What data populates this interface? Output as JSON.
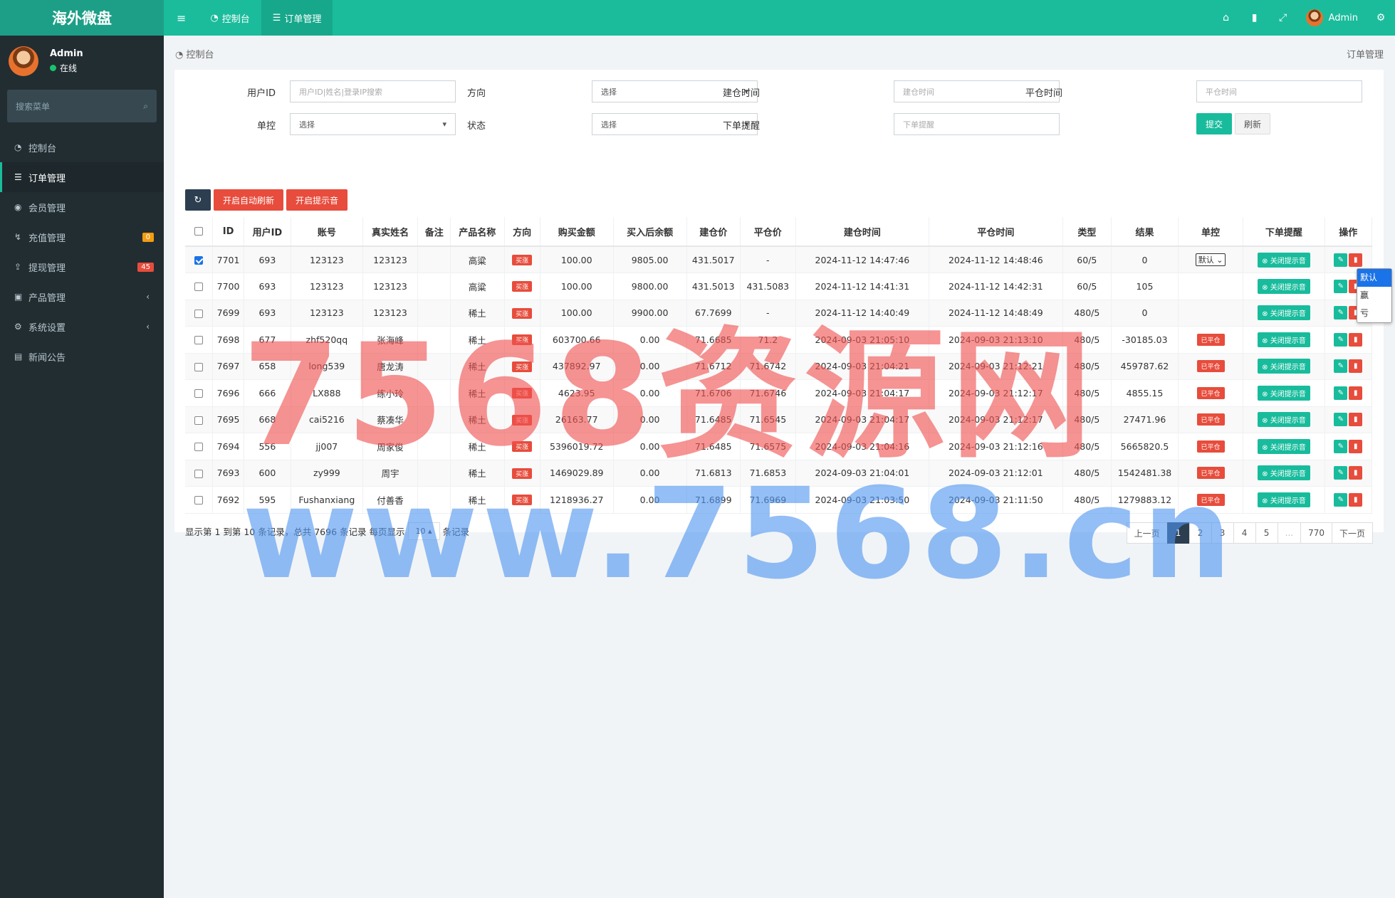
{
  "app": {
    "logo": "海外微盘"
  },
  "user": {
    "name": "Admin",
    "status": "在线"
  },
  "sidebar": {
    "search_placeholder": "搜索菜单",
    "items": [
      {
        "label": "控制台",
        "icon": "dashboard-icon"
      },
      {
        "label": "订单管理",
        "icon": "list-icon",
        "active": true
      },
      {
        "label": "会员管理",
        "icon": "users-icon"
      },
      {
        "label": "充值管理",
        "icon": "recharge-icon",
        "badge": "0",
        "badge_color": "#f39c12"
      },
      {
        "label": "提现管理",
        "icon": "withdraw-icon",
        "badge": "45",
        "badge_color": "#e74c3c"
      },
      {
        "label": "产品管理",
        "icon": "product-icon",
        "caret": "‹"
      },
      {
        "label": "系统设置",
        "icon": "settings-icon",
        "caret": "‹"
      },
      {
        "label": "新闻公告",
        "icon": "news-icon"
      }
    ]
  },
  "topbar": {
    "menu_icon": "≡",
    "tabs": [
      {
        "label": "控制台"
      },
      {
        "label": "订单管理"
      }
    ],
    "admin": "Admin"
  },
  "breadcrumb": {
    "left": "控制台",
    "right": "订单管理"
  },
  "filters": {
    "user_id_label": "用户ID",
    "user_id_placeholder": "用户ID|姓名|登录IP搜索",
    "direction_label": "方向",
    "direction_value": "选择",
    "open_time_label": "建仓时间",
    "open_time_placeholder": "建仓时间",
    "close_time_label": "平仓时间",
    "close_time_placeholder": "平仓时间",
    "control_label": "单控",
    "control_value": "选择",
    "status_label": "状态",
    "status_value": "选择",
    "order_alert_label": "下单提醒",
    "order_alert_placeholder": "下单提醒",
    "submit": "提交",
    "refresh": "刷新"
  },
  "toolbar": {
    "auto_refresh": "开启自动刷新",
    "sound": "开启提示音"
  },
  "table": {
    "headers": [
      "ID",
      "用户ID",
      "账号",
      "真实姓名",
      "备注",
      "产品名称",
      "方向",
      "购买金额",
      "买入后余额",
      "建仓价",
      "平仓价",
      "建仓时间",
      "平仓时间",
      "类型",
      "结果",
      "单控",
      "下单提醒",
      "操作"
    ],
    "direction_tag": "买涨",
    "closed_tag": "已平仓",
    "alert_btn": "关闭提示音",
    "control_default": "默认",
    "rows": [
      {
        "checked": true,
        "id": "7701",
        "uid": "693",
        "account": "123123",
        "name": "123123",
        "note": "",
        "product": "高粱",
        "amount": "100.00",
        "balance": "9805.00",
        "open": "431.5017",
        "close": "-",
        "open_time": "2024-11-12 14:47:46",
        "close_time": "2024-11-12 14:48:46",
        "type": "60/5",
        "result": "0",
        "control": "select"
      },
      {
        "checked": false,
        "id": "7700",
        "uid": "693",
        "account": "123123",
        "name": "123123",
        "note": "",
        "product": "高粱",
        "amount": "100.00",
        "balance": "9800.00",
        "open": "431.5013",
        "close": "431.5083",
        "open_time": "2024-11-12 14:41:31",
        "close_time": "2024-11-12 14:42:31",
        "type": "60/5",
        "result": "105",
        "control": "none"
      },
      {
        "checked": false,
        "id": "7699",
        "uid": "693",
        "account": "123123",
        "name": "123123",
        "note": "",
        "product": "稀土",
        "amount": "100.00",
        "balance": "9900.00",
        "open": "67.7699",
        "close": "-",
        "open_time": "2024-11-12 14:40:49",
        "close_time": "2024-11-12 14:48:49",
        "type": "480/5",
        "result": "0",
        "control": "none"
      },
      {
        "checked": false,
        "id": "7698",
        "uid": "677",
        "account": "zhf520qq",
        "name": "张海峰",
        "note": "",
        "product": "稀土",
        "amount": "603700.66",
        "balance": "0.00",
        "open": "71.6685",
        "close": "71.2",
        "open_time": "2024-09-03 21:05:10",
        "close_time": "2024-09-03 21:13:10",
        "type": "480/5",
        "result": "-30185.03",
        "control": "closed"
      },
      {
        "checked": false,
        "id": "7697",
        "uid": "658",
        "account": "long539",
        "name": "唐龙涛",
        "note": "",
        "product": "稀土",
        "amount": "437892.97",
        "balance": "0.00",
        "open": "71.6712",
        "close": "71.6742",
        "open_time": "2024-09-03 21:04:21",
        "close_time": "2024-09-03 21:12:21",
        "type": "480/5",
        "result": "459787.62",
        "control": "closed"
      },
      {
        "checked": false,
        "id": "7696",
        "uid": "666",
        "account": "LX888",
        "name": "练小玲",
        "note": "",
        "product": "稀土",
        "amount": "4623.95",
        "balance": "0.00",
        "open": "71.6706",
        "close": "71.6746",
        "open_time": "2024-09-03 21:04:17",
        "close_time": "2024-09-03 21:12:17",
        "type": "480/5",
        "result": "4855.15",
        "control": "closed"
      },
      {
        "checked": false,
        "id": "7695",
        "uid": "668",
        "account": "cai5216",
        "name": "蔡凑华",
        "note": "",
        "product": "稀土",
        "amount": "26163.77",
        "balance": "0.00",
        "open": "71.6485",
        "close": "71.6545",
        "open_time": "2024-09-03 21:04:17",
        "close_time": "2024-09-03 21:12:17",
        "type": "480/5",
        "result": "27471.96",
        "control": "closed"
      },
      {
        "checked": false,
        "id": "7694",
        "uid": "556",
        "account": "jj007",
        "name": "周家俊",
        "note": "",
        "product": "稀土",
        "amount": "5396019.72",
        "balance": "0.00",
        "open": "71.6485",
        "close": "71.6575",
        "open_time": "2024-09-03 21:04:16",
        "close_time": "2024-09-03 21:12:16",
        "type": "480/5",
        "result": "5665820.5",
        "control": "closed"
      },
      {
        "checked": false,
        "id": "7693",
        "uid": "600",
        "account": "zy999",
        "name": "周宇",
        "note": "",
        "product": "稀土",
        "amount": "1469029.89",
        "balance": "0.00",
        "open": "71.6813",
        "close": "71.6853",
        "open_time": "2024-09-03 21:04:01",
        "close_time": "2024-09-03 21:12:01",
        "type": "480/5",
        "result": "1542481.38",
        "control": "closed"
      },
      {
        "checked": false,
        "id": "7692",
        "uid": "595",
        "account": "Fushanxiang",
        "name": "付善香",
        "note": "",
        "product": "稀土",
        "amount": "1218936.27",
        "balance": "0.00",
        "open": "71.6899",
        "close": "71.6969",
        "open_time": "2024-09-03 21:03:50",
        "close_time": "2024-09-03 21:11:50",
        "type": "480/5",
        "result": "1279883.12",
        "control": "closed"
      }
    ]
  },
  "dropdown": {
    "options": [
      "默认",
      "赢",
      "亏"
    ],
    "selected": "默认"
  },
  "pagination": {
    "info_prefix": "显示第 1 到第 10 条记录，总共 7696 条记录 每页显示",
    "page_size": "10 ▴",
    "info_suffix": "条记录",
    "prev": "上一页",
    "pages": [
      "1",
      "2",
      "3",
      "4",
      "5",
      "...",
      "770"
    ],
    "current": "1",
    "next": "下一页"
  },
  "watermark": {
    "line1": "7568资源网",
    "line2": "www.7568.cn"
  },
  "colors": {
    "primary": "#1abc9c",
    "sidebar": "#222d32",
    "danger": "#e74c3c",
    "dark": "#2c3e50"
  }
}
